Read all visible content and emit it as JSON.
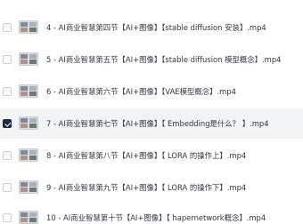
{
  "files": [
    {
      "name": "4 - AI商业智慧第四节【AI+图像】【stable diffusion 安装】.mp4",
      "checked": false,
      "thumbnail_icon": "video-thumbnail-icon"
    },
    {
      "name": "5 - AI商业智慧第五节【AI+图像】【stable diffusion 模型概念】.mp4",
      "checked": false,
      "thumbnail_icon": "video-thumbnail-icon"
    },
    {
      "name": "6 - AI商业智慧第六节【AI+图像】【VAE模型概念】.mp4",
      "checked": false,
      "thumbnail_icon": "video-thumbnail-icon"
    },
    {
      "name": "7 - AI商业智慧第七节【AI+图像】【 Embedding是什么？ 】.mp4",
      "checked": true,
      "thumbnail_icon": "video-thumbnail-icon"
    },
    {
      "name": "8 - AI商业智慧第八节【AI+图像】【 LORA 的操作上】.mp4",
      "checked": false,
      "thumbnail_icon": "video-thumbnail-icon"
    },
    {
      "name": "9 - AI商业智慧第九节【AI+图像】【 LORA 的操作下】.mp4",
      "checked": false,
      "thumbnail_icon": "video-thumbnail-icon"
    },
    {
      "name": "10 - AI商业智慧第十节【AI+图像】【 hapernetwork概念】.mp4",
      "checked": false,
      "thumbnail_icon": "video-thumbnail-icon"
    }
  ]
}
